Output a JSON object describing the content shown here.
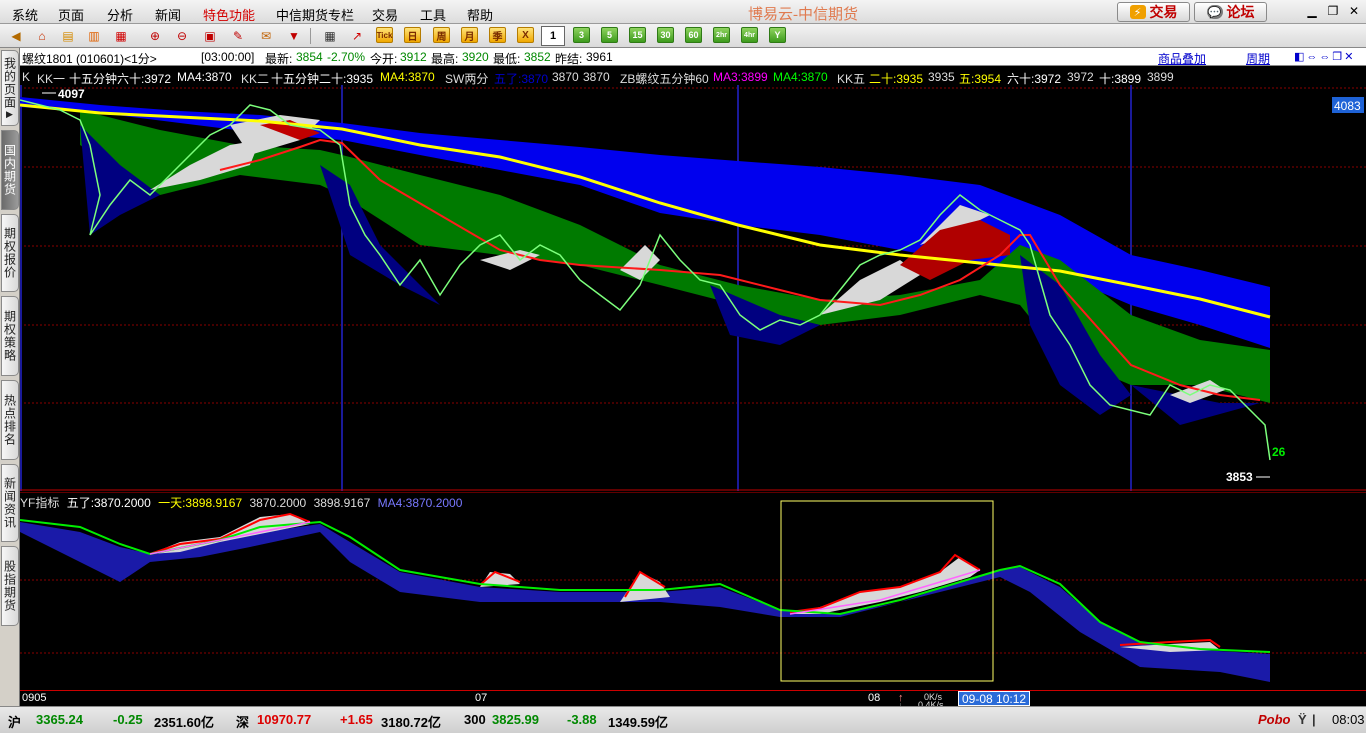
{
  "menu": {
    "items": [
      "系统",
      "页面",
      "分析",
      "新闻",
      "特色功能",
      "中信期货专栏",
      "交易",
      "工具",
      "帮助"
    ],
    "highlight_index": 4
  },
  "app_title": "博易云-中信期货",
  "top_buttons": {
    "trade": "交易",
    "forum": "论坛"
  },
  "toolbar": {
    "periods": [
      "1",
      "3",
      "5",
      "15",
      "30",
      "60",
      "2hr",
      "4hr",
      "Y"
    ],
    "selected_period": "1",
    "calendar_buttons": [
      "日",
      "周",
      "月",
      "季",
      "X"
    ],
    "tick_label": "Tick"
  },
  "left_tabs": [
    "我的页面",
    "国内期货",
    "期权报价",
    "期权策略",
    "热点排名",
    "新闻资讯",
    "股指期货"
  ],
  "chart_header": {
    "symbol": "螺纹1801 (010601)<1分>",
    "time": "[03:00:00]",
    "latest_label": "最新:",
    "latest": "3854",
    "change_pct": "-2.70%",
    "open_label": "今开:",
    "open": "3912",
    "high_label": "最高:",
    "high": "3920",
    "low_label": "最低:",
    "low": "3852",
    "prev_label": "昨结:",
    "prev": "3961",
    "overlay_link": "商品叠加",
    "period_link": "周期"
  },
  "indicator_line": {
    "k_label": "K",
    "kk1": "KK一",
    "kk1_text": "十五分钟六十:3972",
    "kk1_ma": "MA4:3870",
    "kk2": "KK二",
    "kk2_text": "十五分钟二十:3935",
    "kk2_ma": "MA4:3870",
    "sw": "SW两分",
    "sw_a": "五了:3870",
    "sw_b": "3870",
    "sw_c": "3870",
    "zb": "ZB螺纹五分钟60",
    "zb_ma3": "MA3:3899",
    "zb_ma4": "MA4:3870",
    "kk5": "KK五",
    "kk5_20": "二十:3935",
    "kk5_20b": "3935",
    "kk5_5": "五:3954",
    "kk5_60": "六十:3972",
    "kk5_60b": "3972",
    "kk5_10": "十:3899",
    "kk5_10b": "3899"
  },
  "main_chart_labels": {
    "high_marker": "4097",
    "low_marker": "3853",
    "right_price": "4083",
    "countdown": "26"
  },
  "sub_chart": {
    "label": "YF指标",
    "wuliao": "五了:3870.2000",
    "yitian": "一天:3898.9167",
    "v1": "3870.2000",
    "v2": "3898.9167",
    "ma4": "MA4:3870.2000"
  },
  "xaxis": {
    "labels": [
      "0905",
      "07",
      "08"
    ],
    "cursor": "09-08 10:12"
  },
  "net_speed": {
    "up": "0K/s",
    "down": "0.4K/s"
  },
  "statusbar": {
    "sh_label": "沪",
    "sh_index": "3365.24",
    "sh_change": "-0.25",
    "sh_amount": "2351.60亿",
    "sz_label": "深",
    "sz_index": "10970.77",
    "sz_change": "+1.65",
    "sz_amount": "3180.72亿",
    "hs300_label": "300",
    "hs300_index": "3825.99",
    "hs300_change": "-3.88",
    "hs300_amount": "1349.59亿",
    "brand": "Pobo",
    "clock": "08:03"
  },
  "colors": {
    "blue_band": "#0000ff",
    "green_band": "#008000",
    "navy_band": "#000080",
    "yellow_line": "#ffff00",
    "red_line": "#ff0000",
    "price_line": "#00ff00"
  }
}
